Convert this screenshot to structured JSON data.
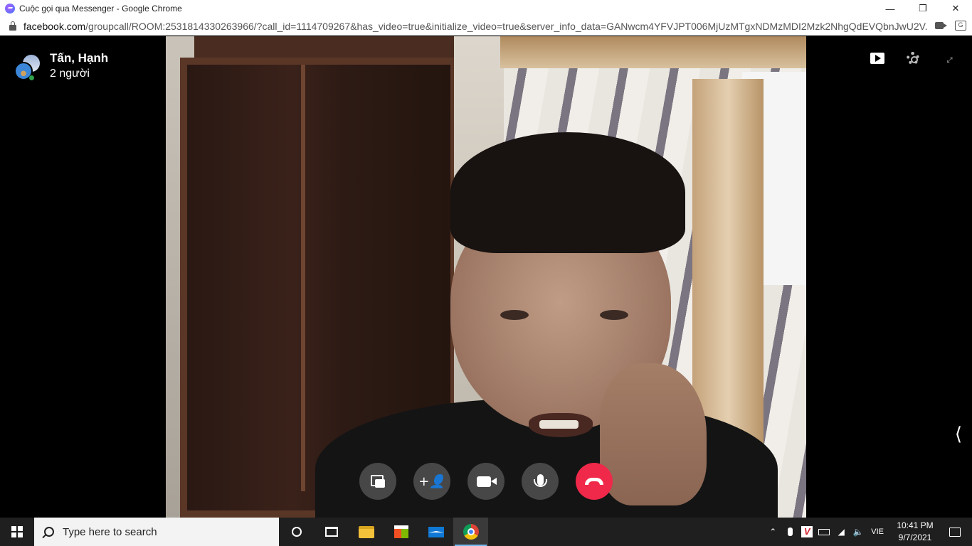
{
  "window": {
    "title": "Cuộc gọi qua Messenger - Google Chrome",
    "url_host": "facebook.com",
    "url_path": "/groupcall/ROOM:2531814330263966/?call_id=1114709267&has_video=true&initialize_video=true&server_info_data=GANwcm4YFVJPT006MjUzMTgxNDMzMDI2Mzk2NhgQdEVQbnJwU2V..."
  },
  "call": {
    "participants_name": "Tấn, Hạnh",
    "participants_count": "2 người"
  },
  "controls": {
    "icons": [
      "screen-share-icon",
      "add-person-icon",
      "video-camera-icon",
      "microphone-icon",
      "hang-up-icon"
    ],
    "end_color": "#f02849"
  },
  "taskbar": {
    "search_placeholder": "Type here to search",
    "language": "VIE",
    "time": "10:41 PM",
    "date": "9/7/2021"
  }
}
